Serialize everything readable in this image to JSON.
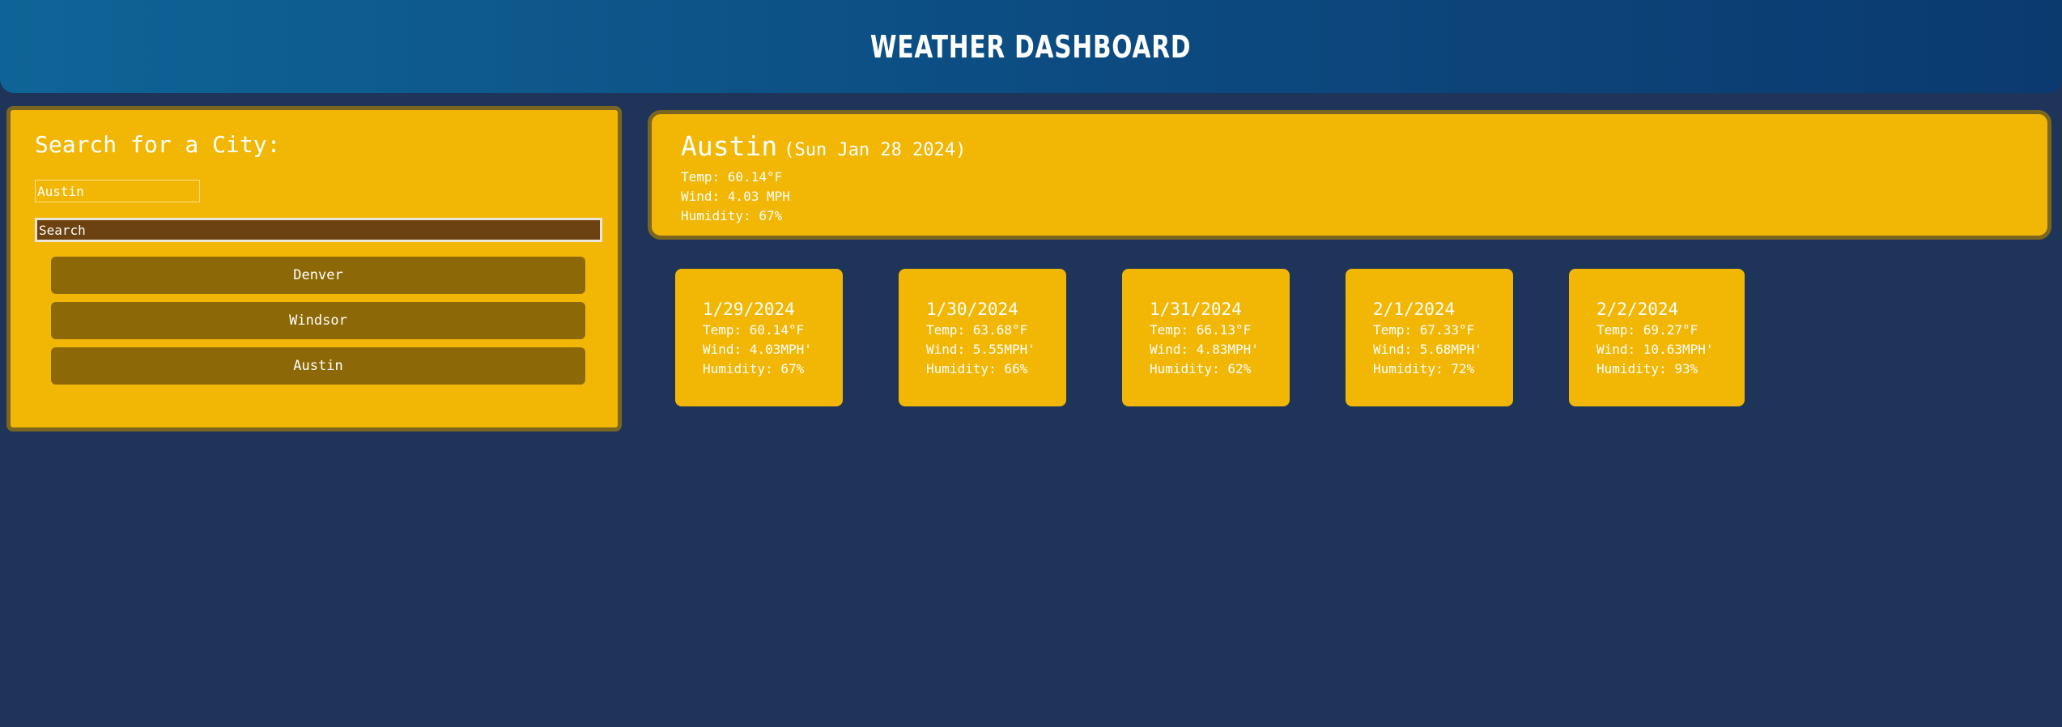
{
  "header": {
    "title": "WEATHER DASHBOARD"
  },
  "search": {
    "heading": "Search for a City:",
    "input_value": "Austin",
    "button_label": "Search",
    "history": [
      "Denver",
      "Windsor",
      "Austin"
    ]
  },
  "current": {
    "city": "Austin",
    "date": "(Sun Jan 28 2024)",
    "temp": "Temp: 60.14°F",
    "wind": "Wind: 4.03 MPH",
    "humidity": "Humidity: 67%"
  },
  "forecast": [
    {
      "date": "1/29/2024",
      "temp": "Temp: 60.14°F",
      "wind": "Wind: 4.03MPH'",
      "humidity": "Humidity: 67%"
    },
    {
      "date": "1/30/2024",
      "temp": "Temp: 63.68°F",
      "wind": "Wind: 5.55MPH'",
      "humidity": "Humidity: 66%"
    },
    {
      "date": "1/31/2024",
      "temp": "Temp: 66.13°F",
      "wind": "Wind: 4.83MPH'",
      "humidity": "Humidity: 62%"
    },
    {
      "date": "2/1/2024",
      "temp": "Temp: 67.33°F",
      "wind": "Wind: 5.68MPH'",
      "humidity": "Humidity: 72%"
    },
    {
      "date": "2/2/2024",
      "temp": "Temp: 69.27°F",
      "wind": "Wind: 10.63MPH'",
      "humidity": "Humidity: 93%"
    }
  ],
  "colors": {
    "background": "#1e3559",
    "card": "#f2b705",
    "history_button": "#8c6906",
    "search_button": "#6b4210",
    "header_gradient_start": "#0f6497",
    "header_gradient_end": "#0b3a6f"
  }
}
